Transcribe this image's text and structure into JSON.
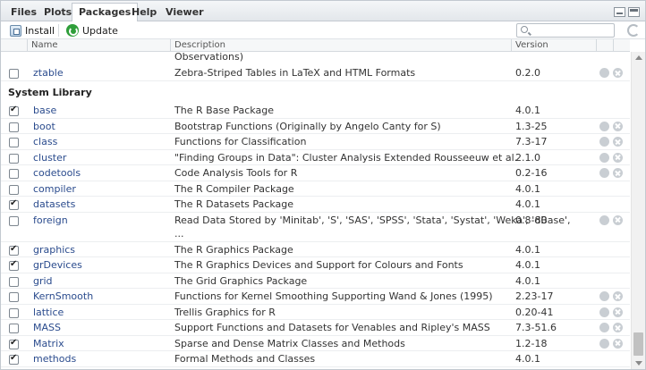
{
  "tabs": [
    "Files",
    "Plots",
    "Packages",
    "Help",
    "Viewer"
  ],
  "toolbar": {
    "install_label": "Install",
    "update_label": "Update",
    "search_placeholder": ""
  },
  "columns": {
    "name": "Name",
    "description": "Description",
    "version": "Version"
  },
  "section_label": "System Library",
  "partial_row": {
    "description_tail": "Observations)",
    "name": "ztable",
    "description": "Zebra-Striped Tables in LaTeX and HTML Formats",
    "version": "0.2.0",
    "checked": false
  },
  "rows": [
    {
      "name": "base",
      "description": "The R Base Package",
      "version": "4.0.1",
      "checked": true,
      "removable": false
    },
    {
      "name": "boot",
      "description": "Bootstrap Functions (Originally by Angelo Canty for S)",
      "version": "1.3-25",
      "checked": false,
      "removable": true
    },
    {
      "name": "class",
      "description": "Functions for Classification",
      "version": "7.3-17",
      "checked": false,
      "removable": true
    },
    {
      "name": "cluster",
      "description": "\"Finding Groups in Data\": Cluster Analysis Extended Rousseeuw et al.",
      "version": "2.1.0",
      "checked": false,
      "removable": true
    },
    {
      "name": "codetools",
      "description": "Code Analysis Tools for R",
      "version": "0.2-16",
      "checked": false,
      "removable": true
    },
    {
      "name": "compiler",
      "description": "The R Compiler Package",
      "version": "4.0.1",
      "checked": false,
      "removable": false
    },
    {
      "name": "datasets",
      "description": "The R Datasets Package",
      "version": "4.0.1",
      "checked": true,
      "removable": false
    },
    {
      "name": "foreign",
      "description": "Read Data Stored by 'Minitab', 'S', 'SAS', 'SPSS', 'Stata', 'Systat', 'Weka', 'dBase',",
      "description_cont": "...",
      "version": "0.8-80",
      "checked": false,
      "removable": true
    },
    {
      "name": "graphics",
      "description": "The R Graphics Package",
      "version": "4.0.1",
      "checked": true,
      "removable": false
    },
    {
      "name": "grDevices",
      "description": "The R Graphics Devices and Support for Colours and Fonts",
      "version": "4.0.1",
      "checked": true,
      "removable": false
    },
    {
      "name": "grid",
      "description": "The Grid Graphics Package",
      "version": "4.0.1",
      "checked": false,
      "removable": false
    },
    {
      "name": "KernSmooth",
      "description": "Functions for Kernel Smoothing Supporting Wand & Jones (1995)",
      "version": "2.23-17",
      "checked": false,
      "removable": true
    },
    {
      "name": "lattice",
      "description": "Trellis Graphics for R",
      "version": "0.20-41",
      "checked": false,
      "removable": true
    },
    {
      "name": "MASS",
      "description": "Support Functions and Datasets for Venables and Ripley's MASS",
      "version": "7.3-51.6",
      "checked": false,
      "removable": true
    },
    {
      "name": "Matrix",
      "description": "Sparse and Dense Matrix Classes and Methods",
      "version": "1.2-18",
      "checked": true,
      "removable": true
    },
    {
      "name": "methods",
      "description": "Formal Methods and Classes",
      "version": "4.0.1",
      "checked": true,
      "removable": false
    }
  ]
}
